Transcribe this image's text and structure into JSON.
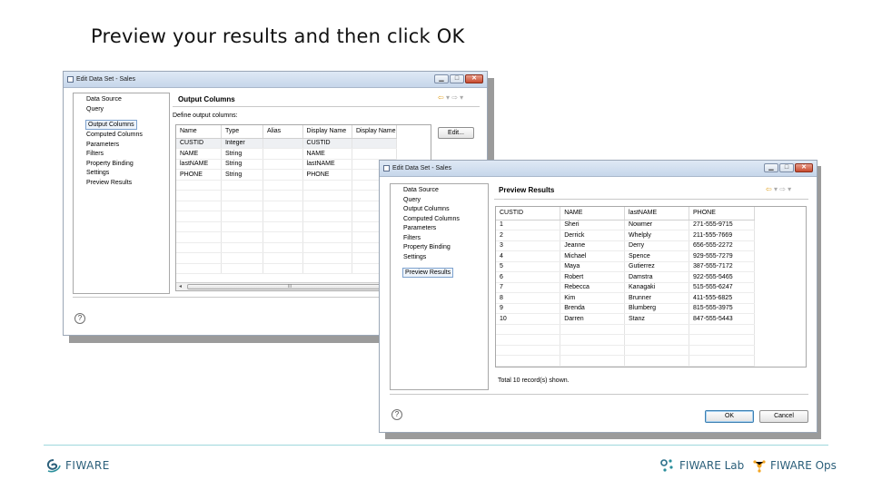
{
  "slide": {
    "title": "Preview your results and then click OK"
  },
  "dialog1": {
    "title": "Edit Data Set - Sales",
    "nav": [
      "Data Source",
      "Query",
      "Output Columns",
      "Computed Columns",
      "Parameters",
      "Filters",
      "Property Binding",
      "Settings",
      "Preview Results"
    ],
    "selected_nav": "Output Columns",
    "pane_title": "Output Columns",
    "pane_subtitle": "Define output columns:",
    "columns": [
      "Name",
      "Type",
      "Alias",
      "Display Name",
      "Display Name"
    ],
    "rows": [
      [
        "CUSTID",
        "Integer",
        "",
        "CUSTID",
        ""
      ],
      [
        "NAME",
        "String",
        "",
        "NAME",
        ""
      ],
      [
        "lastNAME",
        "String",
        "",
        "lastNAME",
        ""
      ],
      [
        "PHONE",
        "String",
        "",
        "PHONE",
        ""
      ]
    ],
    "edit_button": "Edit...",
    "help": "?",
    "scroll_thumb": "III"
  },
  "dialog2": {
    "title": "Edit Data Set - Sales",
    "nav": [
      "Data Source",
      "Query",
      "Output Columns",
      "Computed Columns",
      "Parameters",
      "Filters",
      "Property Binding",
      "Settings",
      "Preview Results"
    ],
    "selected_nav": "Preview Results",
    "pane_title": "Preview Results",
    "columns": [
      "CUSTID",
      "NAME",
      "lastNAME",
      "PHONE"
    ],
    "rows": [
      [
        "1",
        "Sheri",
        "Nowmer",
        "271-555-9715"
      ],
      [
        "2",
        "Derrick",
        "Whelply",
        "211-555-7669"
      ],
      [
        "3",
        "Jeanne",
        "Derry",
        "656-555-2272"
      ],
      [
        "4",
        "Michael",
        "Spence",
        "929-555-7279"
      ],
      [
        "5",
        "Maya",
        "Gutierrez",
        "387-555-7172"
      ],
      [
        "6",
        "Robert",
        "Damstra",
        "922-555-5465"
      ],
      [
        "7",
        "Rebecca",
        "Kanagaki",
        "515-555-6247"
      ],
      [
        "8",
        "Kim",
        "Brunner",
        "411-555-6825"
      ],
      [
        "9",
        "Brenda",
        "Blumberg",
        "815-555-3975"
      ],
      [
        "10",
        "Darren",
        "Stanz",
        "847-555-5443"
      ]
    ],
    "status": "Total 10 record(s) shown.",
    "ok_button": "OK",
    "cancel_button": "Cancel",
    "help": "?"
  },
  "footer": {
    "logo_left": "FIWARE",
    "logo_lab": "FIWARE Lab",
    "logo_ops": "FIWARE Ops"
  },
  "colors": {
    "accent_teal": "#2b8f9c",
    "ops_orange": "#f5a623",
    "titlebar": "#c6d6ea"
  }
}
